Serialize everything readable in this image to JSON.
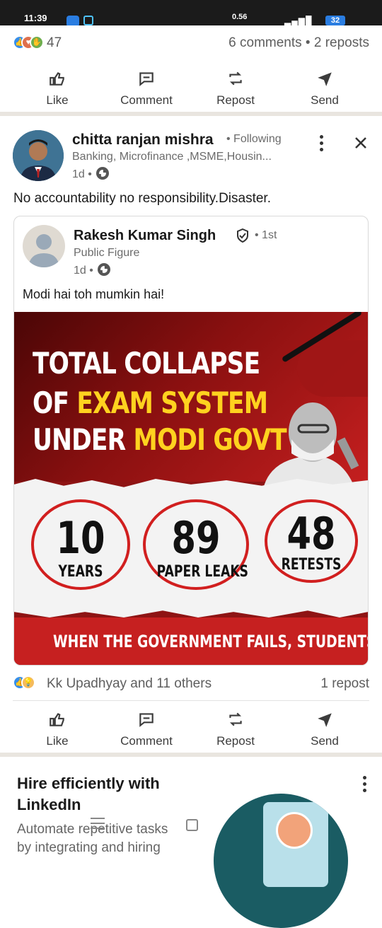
{
  "status_bar": {
    "time": "11:39",
    "network": "0.56",
    "battery": "32"
  },
  "prev_post": {
    "reaction_count": "47",
    "comments_reposts": "6 comments • 2 reposts"
  },
  "actions": {
    "like": "Like",
    "comment": "Comment",
    "repost": "Repost",
    "send": "Send"
  },
  "post": {
    "author": "chitta ranjan mishra",
    "following": "• Following",
    "headline": "Banking, Microfinance ,MSME,Housin...",
    "time": "1d •",
    "text": "No accountability no responsibility.Disaster.",
    "embedded": {
      "author": "Rakesh Kumar Singh",
      "degree": "• 1st",
      "headline": "Public Figure",
      "time": "1d •",
      "text": "Modi hai toh mumkin hai!",
      "graphic": {
        "line1": "TOTAL COLLAPSE",
        "line2_a": "OF ",
        "line2_b": "EXAM SYSTEM",
        "line3_a": "UNDER ",
        "line3_b": "MODI GOVT",
        "stats": [
          {
            "num": "10",
            "label": "YEARS"
          },
          {
            "num": "89",
            "label": "PAPER LEAKS"
          },
          {
            "num": "48",
            "label": "RETESTS"
          }
        ],
        "footer": "WHEN THE GOVERNMENT FAILS, STUDENTS SUFFER"
      }
    },
    "reactions_text": "Kk Upadhyay and 11 others",
    "reposts": "1 repost"
  },
  "ad": {
    "title": "Hire efficiently with LinkedIn",
    "sub1": "Automate repetitive tasks",
    "sub2": "by integrating and hiring"
  },
  "colors": {
    "linkedin_blue": "#0a66c2",
    "banner_red": "#c62020",
    "highlight_yellow": "#ffd21f"
  }
}
